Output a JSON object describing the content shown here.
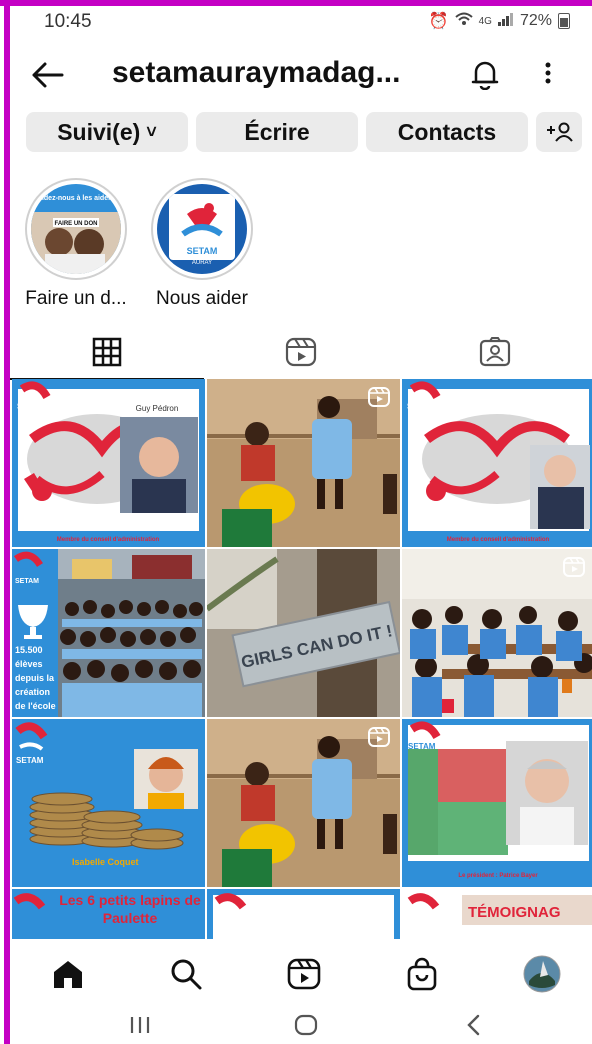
{
  "status_bar": {
    "time": "10:45",
    "network": "4G",
    "battery": "72%"
  },
  "header": {
    "title": "setamauraymadag...",
    "back_icon": "arrow-left-icon",
    "bell_icon": "bell-icon",
    "menu_icon": "more-vertical-icon"
  },
  "actions": {
    "follow_label": "Suivi(e)",
    "follow_chevron": "˅",
    "write_label": "Écrire",
    "contacts_label": "Contacts",
    "add_user_label": "+ꓒ"
  },
  "highlights": [
    {
      "label": "Faire un d...",
      "thumb_text": "Aidez-nous à les aider !",
      "thumb_subtext": "FAIRE UN DON"
    },
    {
      "label": "Nous aider",
      "thumb_text": "SETAM",
      "thumb_subtext": "AURAY"
    }
  ],
  "tabs": [
    "grid",
    "reels",
    "tagged"
  ],
  "posts": [
    {
      "kind": "member",
      "name": "Guy Pédron",
      "caption": "Membre du conseil d'administration",
      "brand": "SETAM"
    },
    {
      "kind": "photo-reel",
      "scene": "kids-washing"
    },
    {
      "kind": "member",
      "name": "",
      "caption": "Membre du conseil d'administration",
      "brand": "SETAM"
    },
    {
      "kind": "crowd",
      "brand": "SETAM",
      "stat_lines": [
        "15.500",
        "élèves",
        "depuis la",
        "création",
        "de l'école"
      ]
    },
    {
      "kind": "sign",
      "sign_text": "GIRLS CAN DO IT !"
    },
    {
      "kind": "classroom-reel"
    },
    {
      "kind": "coins",
      "brand": "SETAM",
      "name": "Isabelle Coquet"
    },
    {
      "kind": "photo-reel",
      "scene": "kids-washing"
    },
    {
      "kind": "president",
      "brand": "SETAM",
      "caption": "Le président : Patrice Bayer"
    },
    {
      "kind": "banner",
      "text": "Les 6 petits lapins de Paulette"
    },
    {
      "kind": "banner-blank"
    },
    {
      "kind": "banner-right",
      "text": "TÉMOIGNAG"
    }
  ],
  "bottom_nav": [
    "home-icon",
    "search-icon",
    "reels-icon",
    "shop-icon",
    "profile-avatar"
  ],
  "colors": {
    "accent_blue": "#2f8fd8",
    "brand_red": "#e0243a",
    "frame": "#c400c4"
  }
}
